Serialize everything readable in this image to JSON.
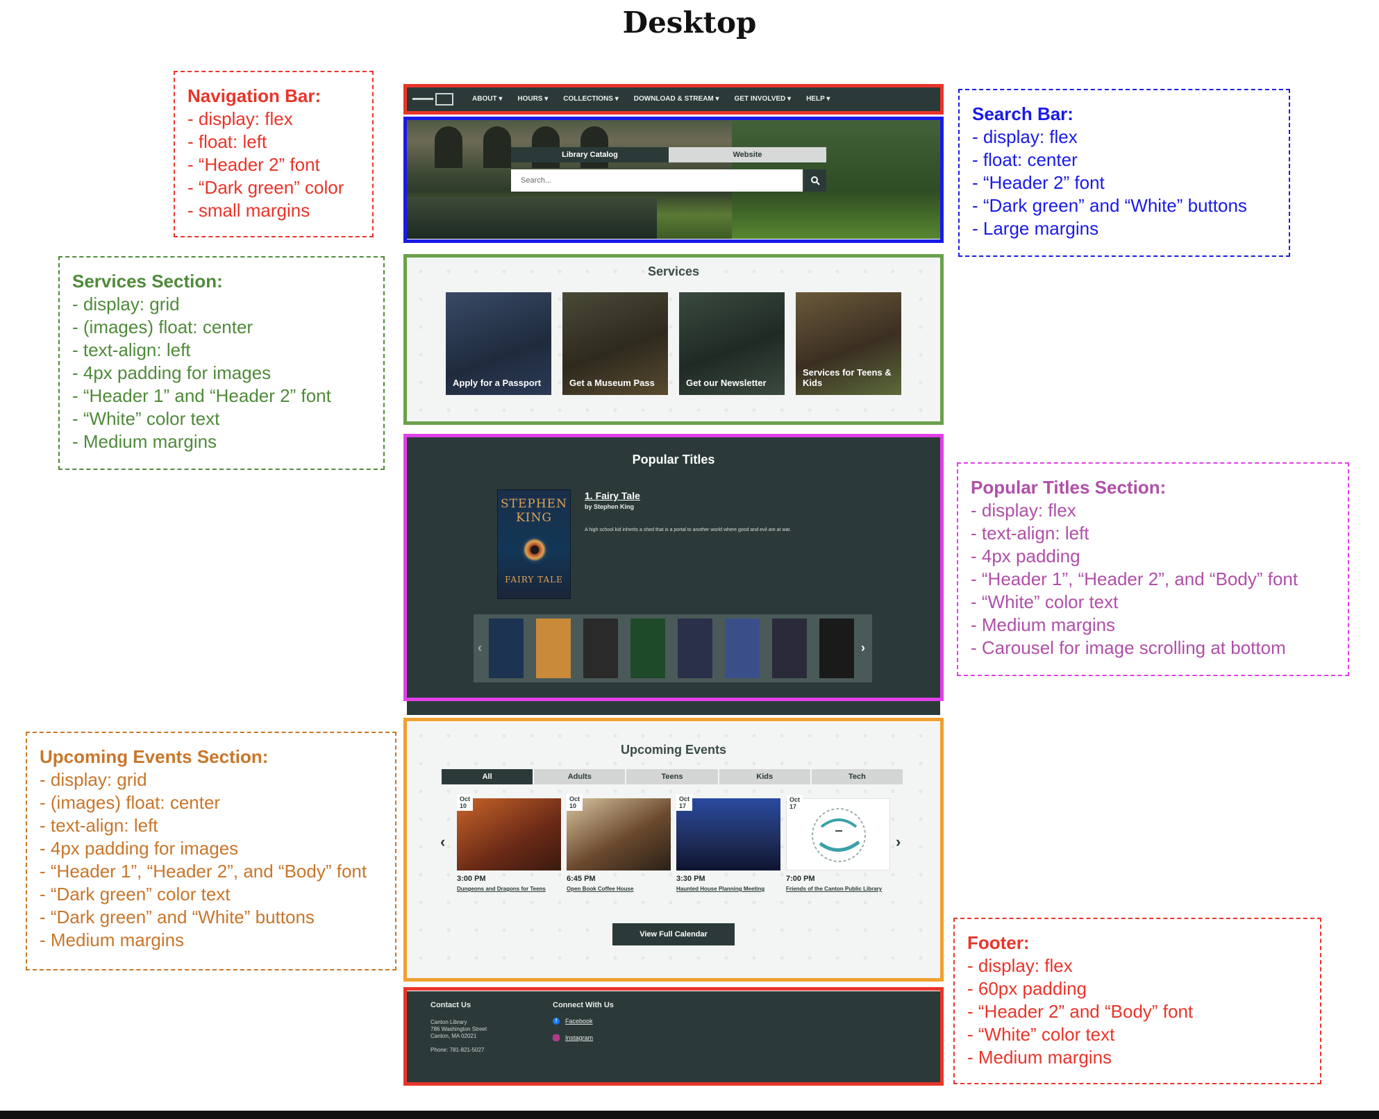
{
  "page_title": "Desktop",
  "notes": {
    "nav": {
      "heading": "Navigation Bar:",
      "lines": [
        "- display: flex",
        "- float: left",
        "- “Header 2” font",
        "- “Dark green” color",
        "- small margins"
      ]
    },
    "search": {
      "heading": "Search Bar:",
      "lines": [
        "- display: flex",
        "- float: center",
        "- “Header 2” font",
        "- “Dark green” and “White” buttons",
        "- Large margins"
      ]
    },
    "services": {
      "heading": "Services Section:",
      "lines": [
        "- display: grid",
        "- (images) float: center",
        "- text-align: left",
        "- 4px padding for images",
        "- “Header 1” and “Header 2” font",
        "- “White” color text",
        "- Medium margins"
      ]
    },
    "popular": {
      "heading": "Popular Titles Section:",
      "lines": [
        "- display: flex",
        "- text-align: left",
        "- 4px padding",
        "- “Header 1”, “Header 2”, and “Body” font",
        "- “White” color text",
        "- Medium margins",
        "- Carousel for image scrolling at bottom"
      ]
    },
    "events": {
      "heading": "Upcoming Events Section:",
      "lines": [
        "- display: grid",
        "- (images) float: center",
        "- text-align: left",
        "- 4px padding for images",
        "- “Header 1”, “Header 2”, and “Body” font",
        "- “Dark green” color text",
        "- “Dark green” and “White” buttons",
        "- Medium margins"
      ]
    },
    "footer": {
      "heading": "Footer:",
      "lines": [
        "- display: flex",
        "- 60px padding",
        "- “Header 2” and “Body” font",
        "- “White” color text",
        "- Medium margins"
      ]
    }
  },
  "colors": {
    "dark_green": "#2b3a39",
    "nav_frame": "#e8352a",
    "search_frame": "#1a1ae6",
    "services_frame": "#6aa04a",
    "popular_frame": "#e040e8",
    "events_frame": "#f0a030",
    "footer_frame": "#e8352a"
  },
  "mockup": {
    "nav": {
      "items": [
        "ABOUT ▾",
        "HOURS ▾",
        "COLLECTIONS ▾",
        "DOWNLOAD & STREAM ▾",
        "GET INVOLVED ▾",
        "HELP ▾"
      ]
    },
    "search": {
      "tab_active": "Library Catalog",
      "tab_inactive": "Website",
      "placeholder": "Search...",
      "icon": "search-icon"
    },
    "services": {
      "title": "Services",
      "items": [
        {
          "label": "Apply for a Passport",
          "color": "#25303f"
        },
        {
          "label": "Get a Museum Pass",
          "color": "#3a3526"
        },
        {
          "label": "Get our Newsletter",
          "color": "#28302a"
        },
        {
          "label": "Services for Teens & Kids",
          "color": "#4b3c2b"
        }
      ]
    },
    "popular": {
      "title": "Popular Titles",
      "featured_title": "1. Fairy Tale",
      "featured_author": "by Stephen King",
      "featured_desc": "A high school kid inherits a shed that is a portal to another world where good and evil are at war.",
      "cover_author": "STEPHEN KING",
      "cover_title": "FAIRY TALE",
      "thumbs": [
        "#1d3352",
        "#c98a3a",
        "#2a2a2a",
        "#1f4a2a",
        "#2a2f4a",
        "#3a4f8a",
        "#2a2a3a",
        "#1a1a1a"
      ]
    },
    "events": {
      "title": "Upcoming Events",
      "tabs": [
        "All",
        "Adults",
        "Teens",
        "Kids",
        "Tech"
      ],
      "items": [
        {
          "month": "Oct",
          "day": "10",
          "time": "3:00 PM",
          "name": "Dungeons and Dragons for Teens",
          "color": "#8a3a1e"
        },
        {
          "month": "Oct",
          "day": "10",
          "time": "6:45 PM",
          "name": "Open Book Coffee House",
          "color": "#6b4a2e"
        },
        {
          "month": "Oct",
          "day": "17",
          "time": "3:30 PM",
          "name": "Haunted House Planning Meeting",
          "color": "#1f2d5a"
        },
        {
          "month": "Oct",
          "day": "17",
          "time": "7:00 PM",
          "name": "Friends of the Canton Public Library",
          "color": "#ffffff"
        }
      ],
      "button": "View Full Calendar"
    },
    "footer": {
      "contact_heading": "Contact Us",
      "address_lines": [
        "Canton Library",
        "786 Washington Street",
        "Canton, MA 02021"
      ],
      "phone": "Phone: 781-821-5027",
      "connect_heading": "Connect With Us",
      "links": [
        "Facebook",
        "Instagram"
      ]
    }
  }
}
